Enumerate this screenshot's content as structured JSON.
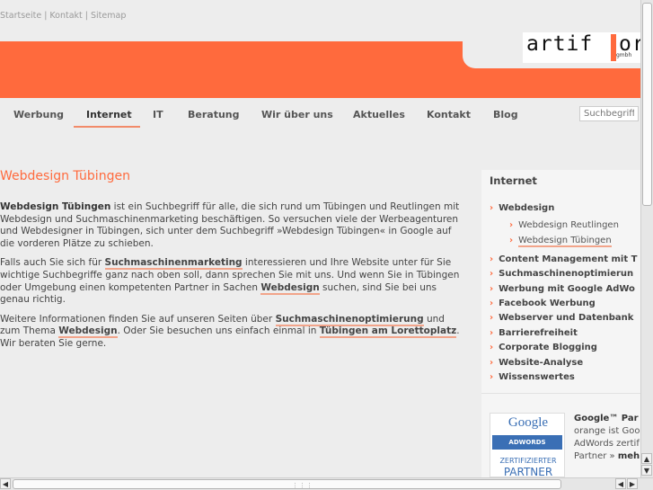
{
  "top_links": [
    "Startseite",
    "Kontakt",
    "Sitemap"
  ],
  "top_link_separator": "|",
  "logo": {
    "word": "artif",
    "word2": "or",
    "sub": "gmbh"
  },
  "nav": {
    "items": [
      "Werbung",
      "Internet",
      "IT",
      "Beratung",
      "Wir über uns",
      "Aktuelles",
      "Kontakt",
      "Blog"
    ],
    "active": "Internet"
  },
  "search": {
    "placeholder": "Suchbegriff"
  },
  "main": {
    "title": "Webdesign Tübingen",
    "p1": {
      "lead": "Webdesign Tübingen",
      "rest": " ist ein Suchbegriff für alle, die sich rund um Tübingen und Reutlingen mit Webdesign und Suchmaschinenmarketing beschäftigen. So versuchen viele der Werbeagenturen und Webdesigner in Tübingen, sich unter dem Suchbegriff »Webdesign Tübingen« in Google auf die vorderen Plätze zu schieben."
    },
    "p2": {
      "t1": "Falls auch Sie sich für ",
      "l1": "Suchmaschinenmarketing",
      "t2": " interessieren und Ihre Website unter für Sie wichtige Suchbegriffe ganz nach oben soll, dann sprechen Sie mit uns. Und wenn Sie in Tübingen oder Umgebung einen kompetenten Partner in Sachen ",
      "l2": "Webdesign",
      "t3": " suchen, sind Sie bei uns genau richtig."
    },
    "p3": {
      "t1": "Weitere Informationen finden Sie auf unseren Seiten über ",
      "l1": "Suchmaschinenoptimierung",
      "t2": " und zum Thema ",
      "l2": "Webdesign",
      "t3": ". Oder Sie besuchen uns einfach einmal in ",
      "l3": "Tübingen am Lorettoplatz",
      "t4": ". Wir beraten Sie gerne."
    }
  },
  "sidebar": {
    "title": "Internet",
    "items": [
      "Webdesign",
      "Content Management mit T",
      "Suchmaschinenoptimierun",
      "Werbung mit Google AdWo",
      "Facebook Werbung",
      "Webserver und Datenbank",
      "Barrierefreiheit",
      "Corporate Blogging",
      "Website-Analyse",
      "Wissenswertes"
    ],
    "subitems": [
      "Webdesign Reutlingen",
      "Webdesign Tübingen"
    ],
    "current_sub": "Webdesign Tübingen"
  },
  "google_partner": {
    "badge_logo": "Google",
    "badge_adwords": "ADWORDS",
    "badge_zert": "ZERTIFIZIERTER",
    "badge_partner": "PARTNER",
    "title": "Google™ Par",
    "line1": "orange ist Goo",
    "line2": "AdWords zertif",
    "line3": "Partner »",
    "more": "meh"
  },
  "colors": {
    "accent": "#ff6a3d",
    "underline": "#f2a48a",
    "background": "#ededed",
    "sidebar_bg": "#f5f5f5"
  },
  "icons": {
    "chevron": "chevron-right-icon",
    "scroll_up": "arrow-up-icon",
    "scroll_down": "arrow-down-icon",
    "scroll_left": "arrow-left-icon",
    "scroll_right": "arrow-right-icon"
  }
}
